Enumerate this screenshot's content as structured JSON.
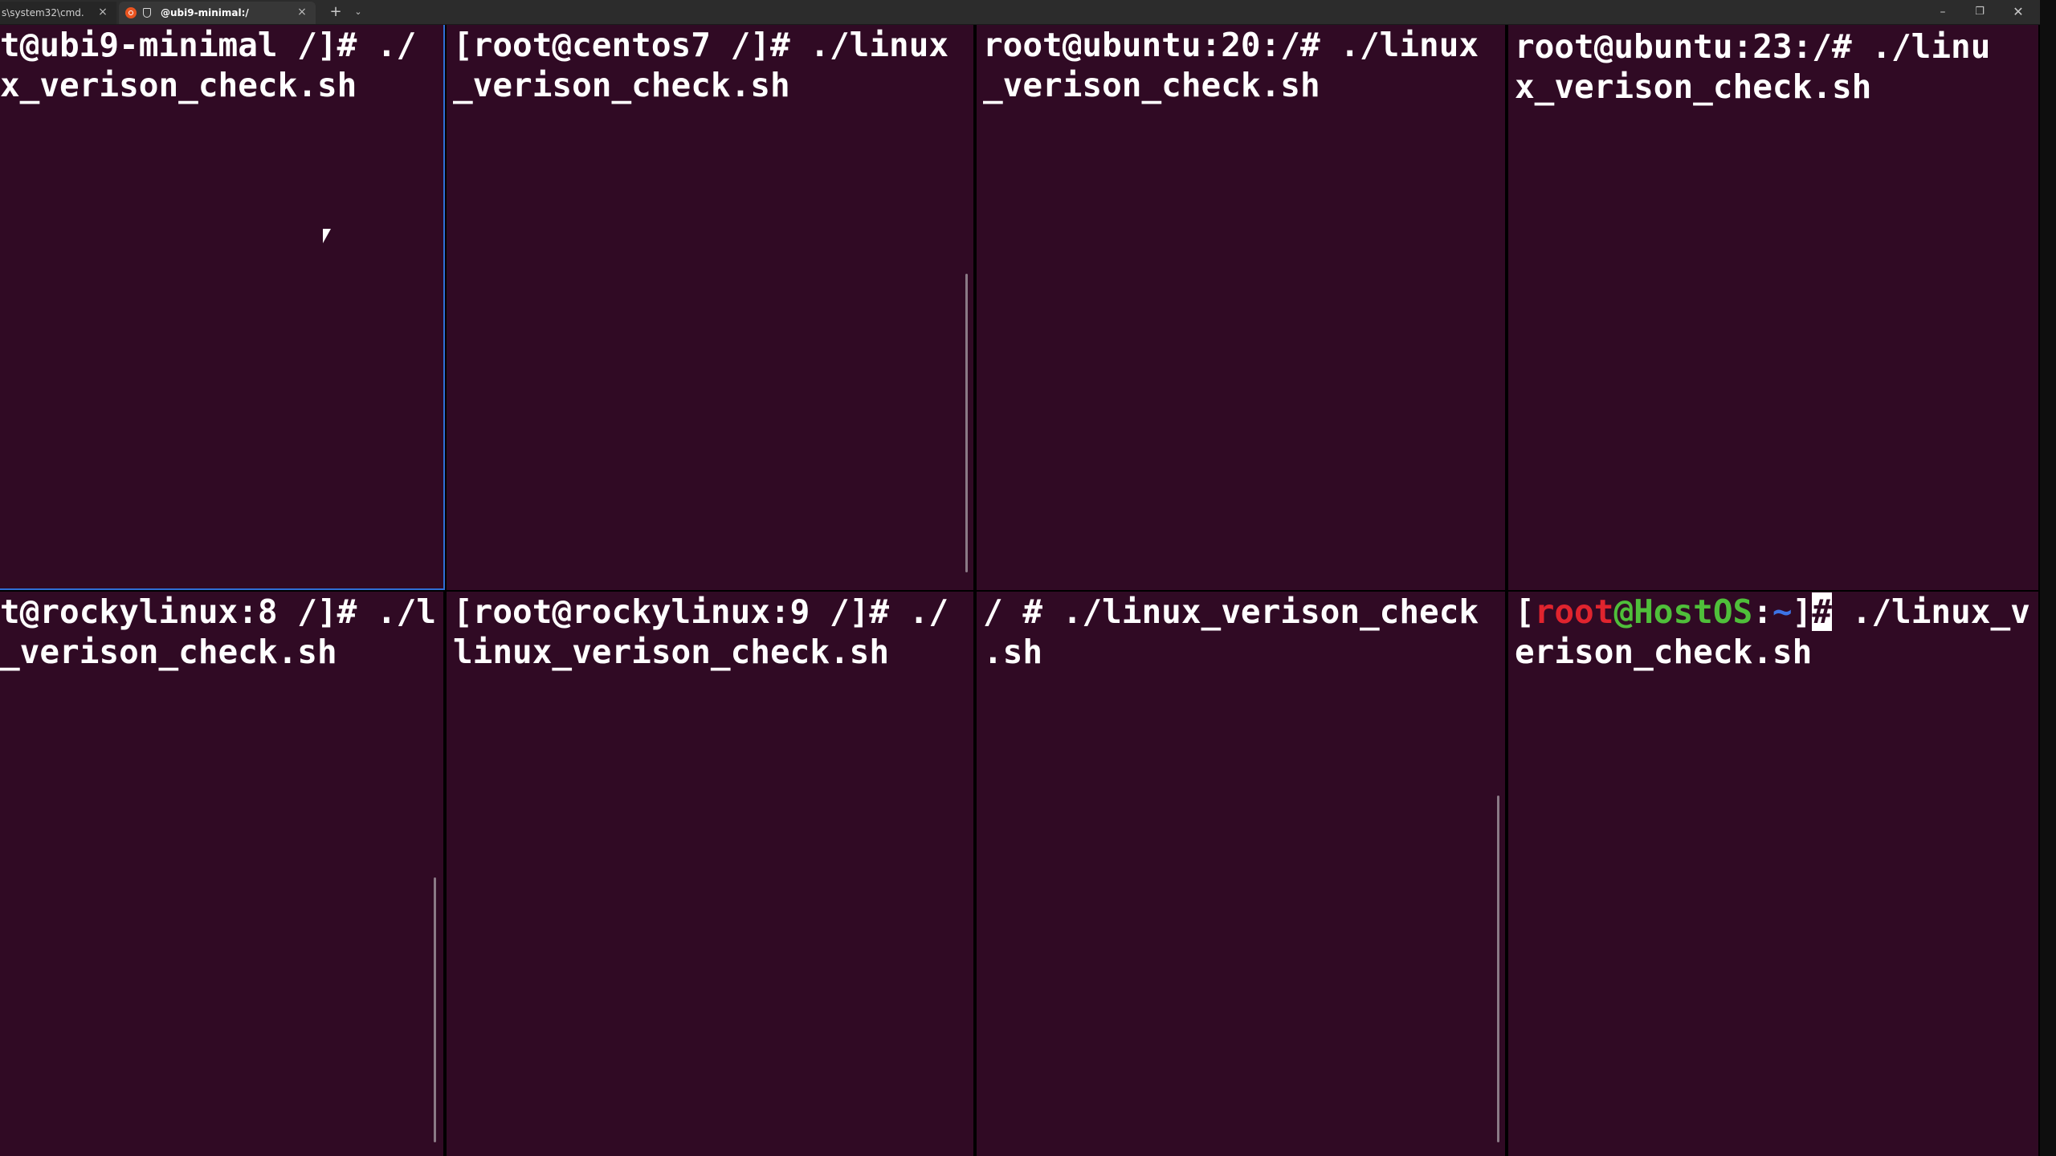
{
  "window": {
    "tabs": [
      {
        "label": "s\\system32\\cmd.",
        "icon": "terminal-icon"
      },
      {
        "label": "@ubi9-minimal:/",
        "icon": "ubuntu-icon"
      }
    ],
    "new_tab_label": "+",
    "dropdown_label": "⌄",
    "minimize_label": "–",
    "maximize_label": "❐",
    "close_label": "✕"
  },
  "panes": [
    {
      "line1": "t@ubi9-minimal /]# ./",
      "line2": "x_verison_check.sh"
    },
    {
      "line1": "[root@centos7 /]# ./linux",
      "line2": "_verison_check.sh"
    },
    {
      "line1": "root@ubuntu:20:/# ./linux",
      "line2": "_verison_check.sh"
    },
    {
      "line1": "root@ubuntu:23:/# ./linu",
      "line2": "x_verison_check.sh"
    },
    {
      "line1": "t@rockylinux:8 /]# ./l",
      "line2": "_verison_check.sh"
    },
    {
      "line1": "[root@rockylinux:9 /]# ./",
      "line2": "linux_verison_check.sh"
    },
    {
      "line1": "/ # ./linux_verison_check",
      "line2": ".sh"
    },
    {
      "prompt": {
        "open_bracket": "[",
        "user": "root",
        "at": "@",
        "host": "HostOS",
        "colon": ":",
        "path": "~",
        "close_bracket": "]",
        "symbol": "#"
      },
      "line1_rest": " ./linux_v",
      "line2": "erison_check.sh"
    }
  ],
  "colors": {
    "terminal_bg": "#300a24",
    "active_border": "#2f6fd6",
    "text": "#ffffff",
    "prompt_user": "#e0242e",
    "prompt_host": "#4fbf3a",
    "prompt_path": "#3c74e6"
  }
}
